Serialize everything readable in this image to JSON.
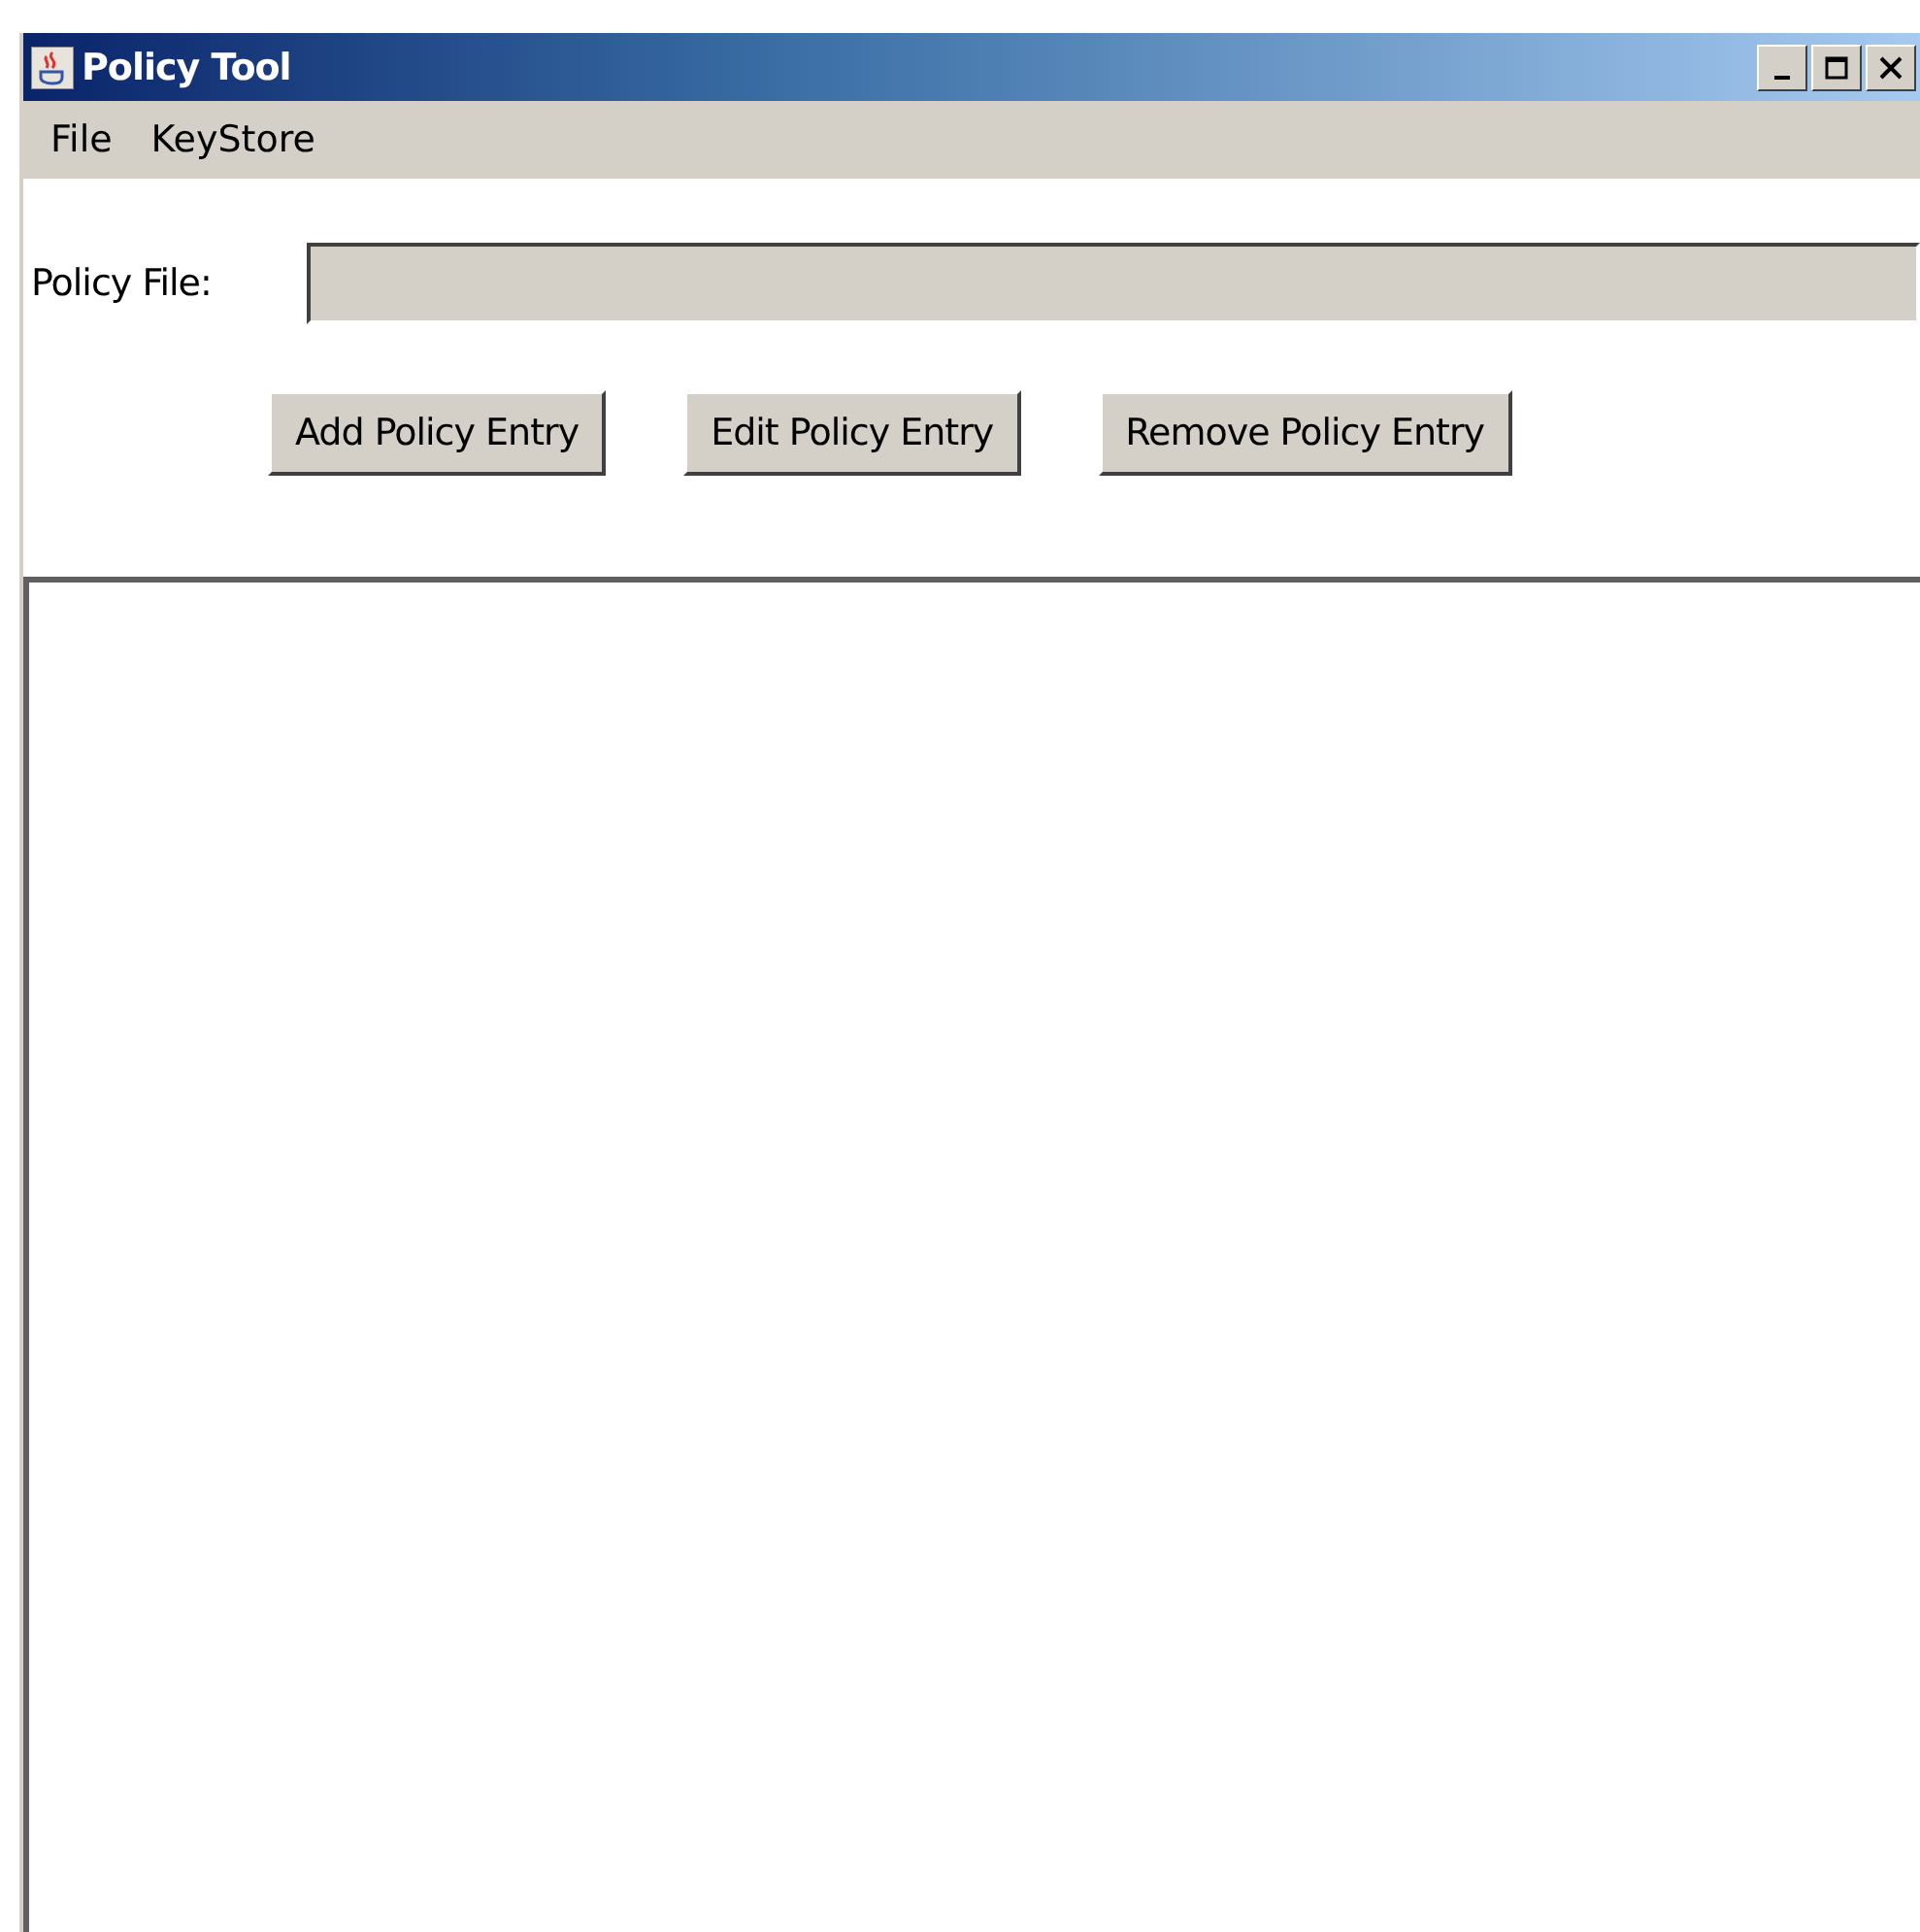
{
  "window": {
    "title": "Policy Tool"
  },
  "menu": [
    {
      "label": "File"
    },
    {
      "label": "KeyStore"
    }
  ],
  "policy_file": {
    "label": "Policy File:"
  },
  "buttons": [
    {
      "label": "Add Policy Entry"
    },
    {
      "label": "Edit Policy Entry"
    },
    {
      "label": "Remove Policy Entry"
    }
  ]
}
